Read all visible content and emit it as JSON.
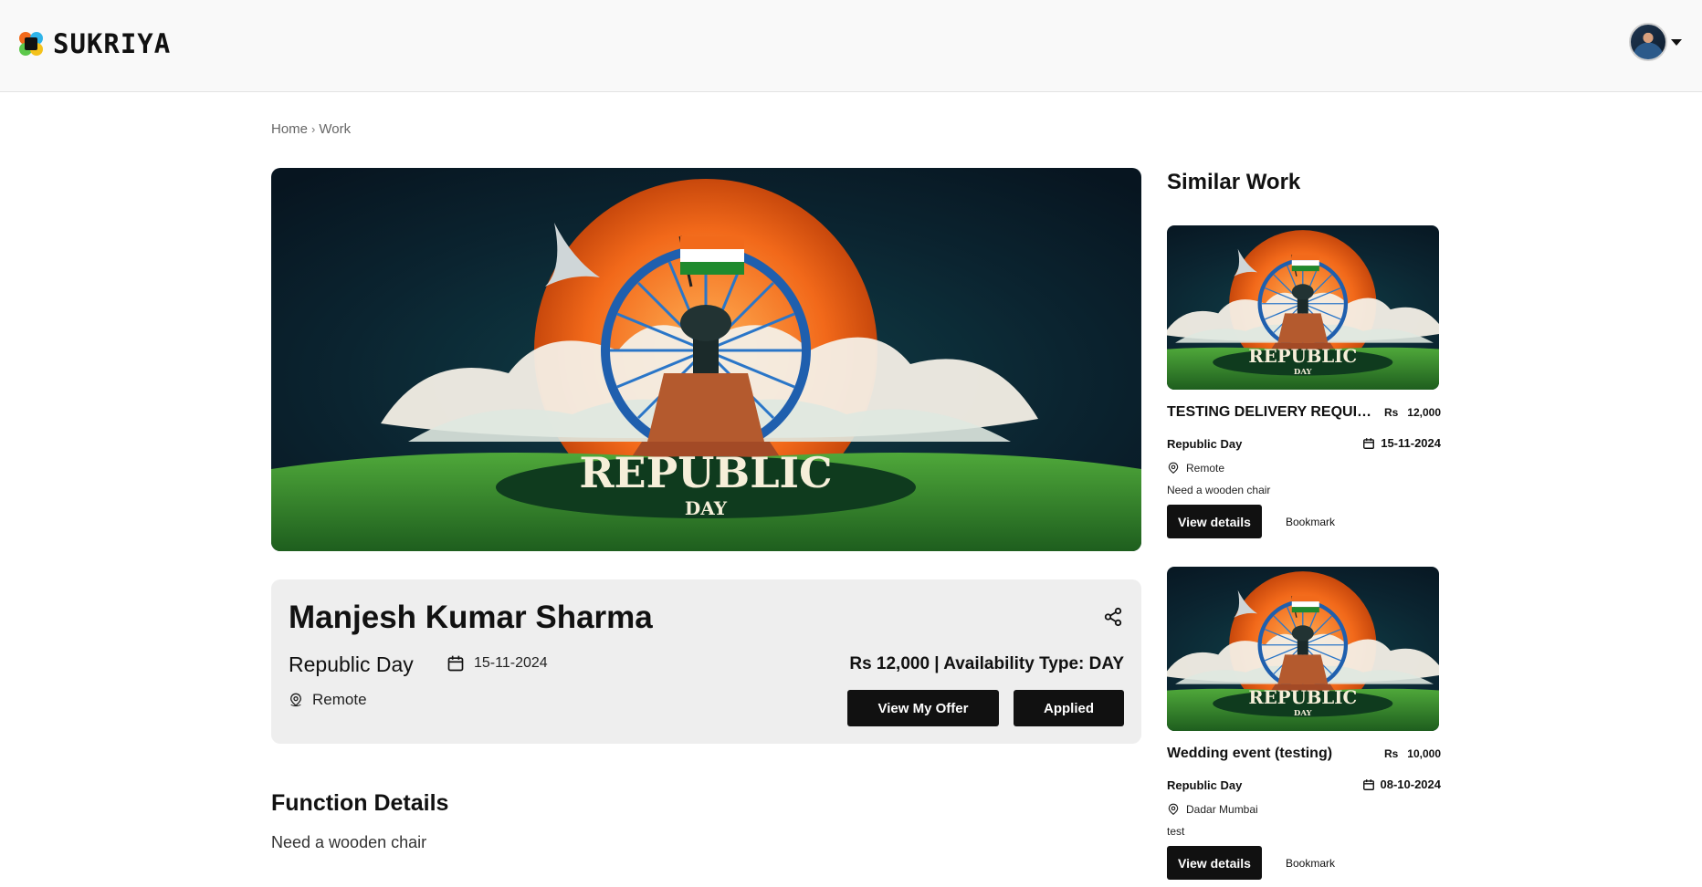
{
  "brand": {
    "name": "SUKRIYA"
  },
  "breadcrumb": {
    "home": "Home",
    "separator": "›",
    "current": "Work"
  },
  "hero": {
    "banner_line1": "REPUBLIC",
    "banner_line2": "DAY"
  },
  "detail": {
    "name": "Manjesh Kumar Sharma",
    "category": "Republic Day",
    "date": "15-11-2024",
    "location": "Remote",
    "price_line": "Rs 12,000 | Availability Type: DAY",
    "view_offer_label": "View My Offer",
    "applied_label": "Applied"
  },
  "function_details": {
    "title": "Function Details",
    "text": "Need a wooden chair"
  },
  "similar": {
    "title": "Similar Work",
    "items": [
      {
        "title": "TESTING DELIVERY REQUIREMENT",
        "currency": "Rs",
        "amount": "12,000",
        "category": "Republic Day",
        "date": "15-11-2024",
        "location": "Remote",
        "description": "Need a wooden chair",
        "view_label": "View details",
        "bookmark_label": "Bookmark"
      },
      {
        "title": "Wedding event (testing)",
        "currency": "Rs",
        "amount": "10,000",
        "category": "Republic Day",
        "date": "08-10-2024",
        "location": "Dadar Mumbai",
        "description": "test",
        "view_label": "View details",
        "bookmark_label": "Bookmark"
      }
    ]
  },
  "colors": {
    "accent": "#111111",
    "card_bg": "#eeeeee",
    "saffron": "#f26a1b",
    "green": "#2e8b2e",
    "navy": "#0a1a2a"
  }
}
